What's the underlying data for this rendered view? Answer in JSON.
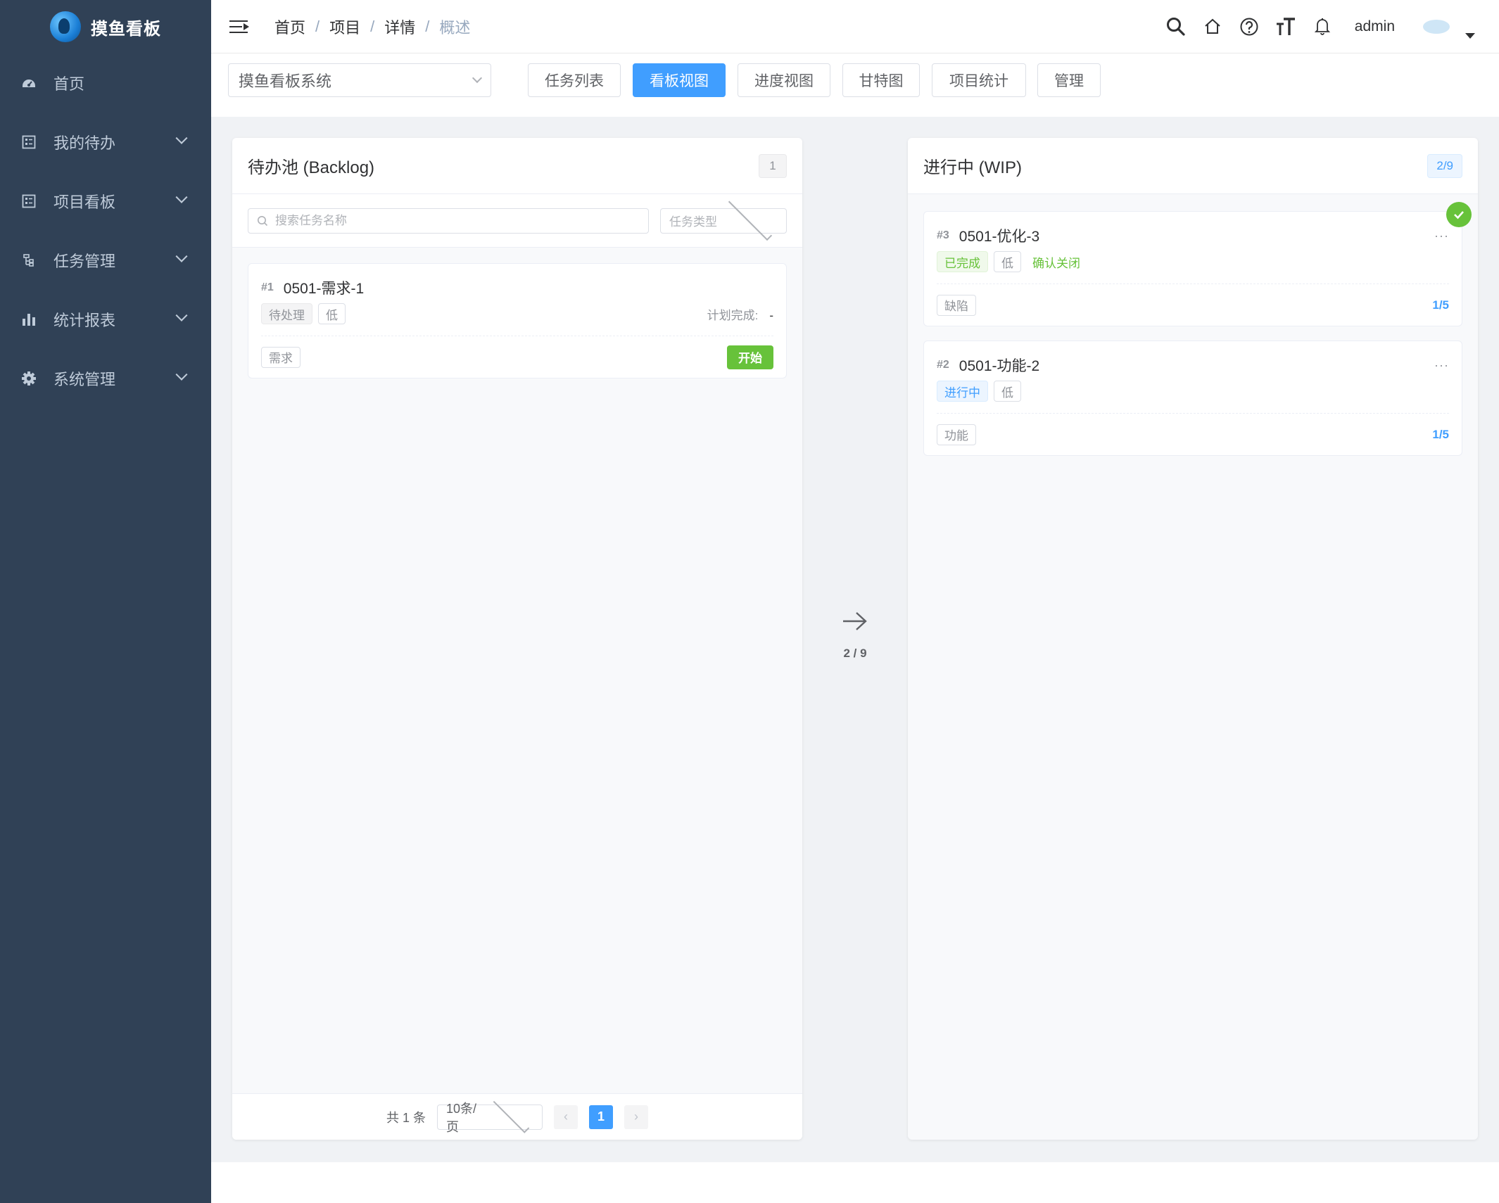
{
  "app": {
    "logo_text": "摸鱼看板"
  },
  "sidebar": {
    "items": [
      {
        "label": "首页",
        "icon": "dashboard-icon",
        "expandable": false
      },
      {
        "label": "我的待办",
        "icon": "list-icon",
        "expandable": true
      },
      {
        "label": "项目看板",
        "icon": "list-icon",
        "expandable": true
      },
      {
        "label": "任务管理",
        "icon": "tree-icon",
        "expandable": true
      },
      {
        "label": "统计报表",
        "icon": "bar-chart-icon",
        "expandable": true
      },
      {
        "label": "系统管理",
        "icon": "gear-icon",
        "expandable": true
      }
    ]
  },
  "header": {
    "breadcrumb": [
      "首页",
      "项目",
      "详情",
      "概述"
    ],
    "username": "admin"
  },
  "toolbar": {
    "project_select": "摸鱼看板系统",
    "tabs": [
      "任务列表",
      "看板视图",
      "进度视图",
      "甘特图",
      "项目统计",
      "管理"
    ],
    "active_tab": "看板视图"
  },
  "backlog": {
    "title": "待办池 (Backlog)",
    "count": "1",
    "search_placeholder": "搜索任务名称",
    "type_placeholder": "任务类型",
    "cards": [
      {
        "id": "#1",
        "name": "0501-需求-1",
        "status": "待处理",
        "priority": "低",
        "plan_label": "计划完成:",
        "plan_value": "-",
        "type": "需求",
        "action": "开始"
      }
    ],
    "pager": {
      "total": "共 1 条",
      "page_size": "10条/页",
      "current_page": "1",
      "prev": "‹",
      "next": "›"
    }
  },
  "flow": {
    "label": "2 / 9"
  },
  "wip": {
    "title": "进行中 (WIP)",
    "count": "2/9",
    "cards": [
      {
        "id": "#3",
        "name": "0501-优化-3",
        "status": "已完成",
        "status_color": "#67c23a",
        "priority": "低",
        "extra": "确认关闭",
        "type": "缺陷",
        "progress": "1/5",
        "more": "···"
      },
      {
        "id": "#2",
        "name": "0501-功能-2",
        "status": "进行中",
        "status_color": "#409eff",
        "priority": "低",
        "type": "功能",
        "progress": "1/5",
        "more": "···"
      }
    ]
  },
  "colors": {
    "sidebar_bg": "#304156",
    "primary": "#409eff",
    "success": "#67c23a"
  }
}
